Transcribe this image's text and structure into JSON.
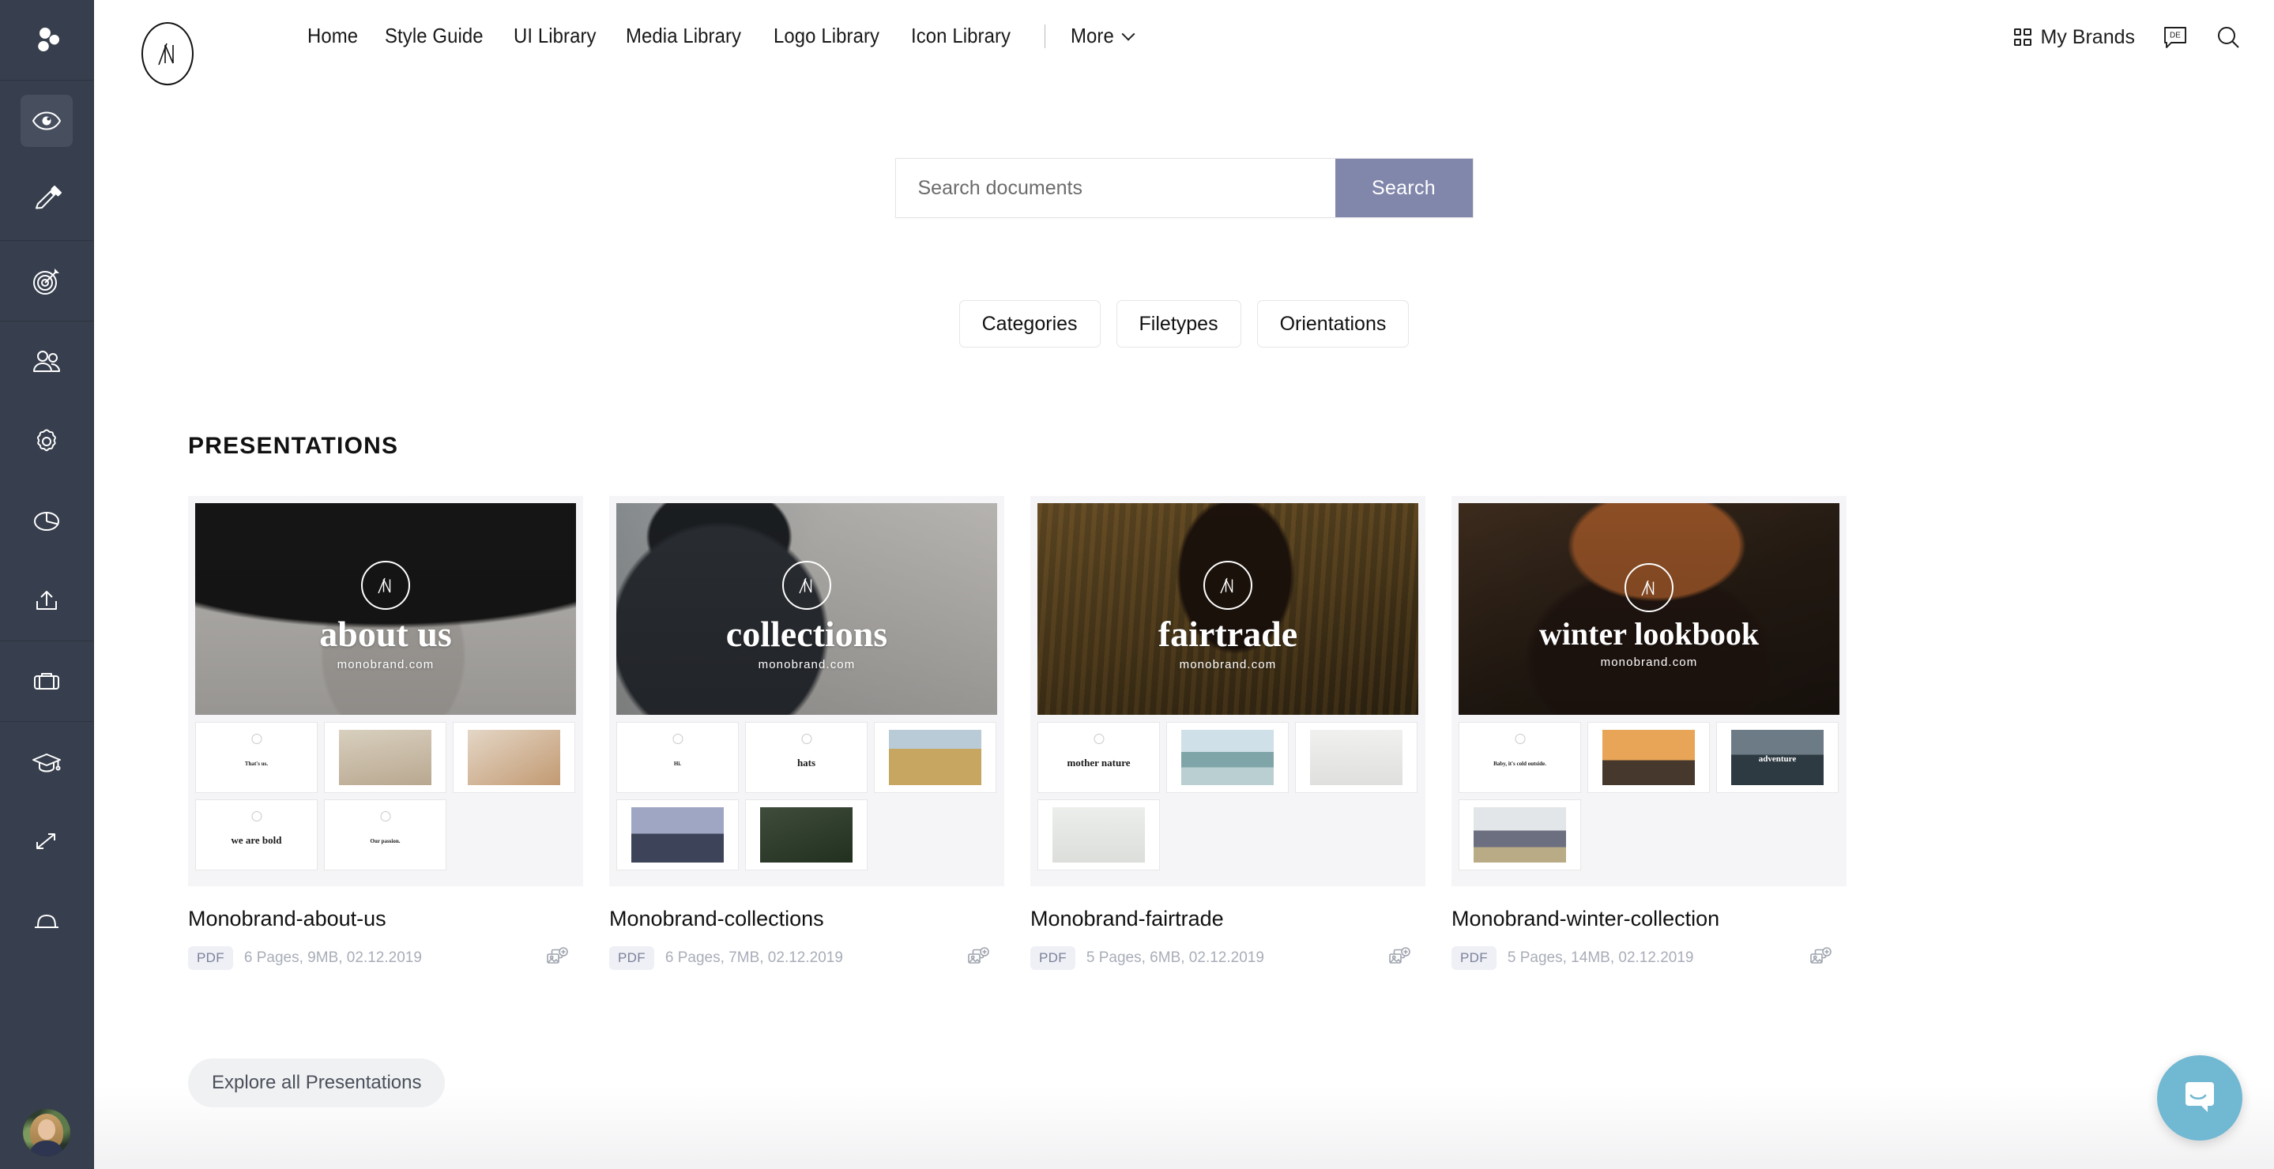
{
  "theme": {
    "sidebar_bg": "#373e4d",
    "sidebar_active_bg": "#474e5e",
    "search_button_bg": "#8186ab",
    "chat_fab_bg": "#71b8d2",
    "page_bg": "#ffffff",
    "card_thumb_bg": "#f5f5f7",
    "muted_text": "#a9adb8",
    "pdf_badge_bg": "#eef0f6"
  },
  "sidebar": {
    "groups": [
      {
        "items": [
          {
            "name": "brand-logo",
            "icon": "clover-logo-icon",
            "active": false
          }
        ]
      },
      {
        "items": [
          {
            "name": "preview",
            "icon": "eye-icon",
            "active": true
          },
          {
            "name": "edit",
            "icon": "pencil-icon",
            "active": false
          }
        ]
      },
      {
        "items": [
          {
            "name": "goals",
            "icon": "target-icon",
            "active": false
          }
        ]
      },
      {
        "items": [
          {
            "name": "users",
            "icon": "people-icon",
            "active": false
          },
          {
            "name": "settings",
            "icon": "gear-icon",
            "active": false
          },
          {
            "name": "analytics",
            "icon": "pie-chart-icon",
            "active": false
          },
          {
            "name": "share",
            "icon": "upload-share-icon",
            "active": false
          }
        ]
      },
      {
        "items": [
          {
            "name": "portfolio",
            "icon": "briefcase-icon",
            "active": false
          }
        ]
      },
      {
        "items": [
          {
            "name": "academy",
            "icon": "graduation-cap-icon",
            "active": false
          },
          {
            "name": "expand",
            "icon": "expand-arrows-icon",
            "active": false
          },
          {
            "name": "notifications",
            "icon": "bell-icon",
            "active": false
          }
        ]
      }
    ],
    "avatar_name": "user-avatar"
  },
  "header": {
    "logo_letter": "M",
    "nav_links": [
      "Home",
      "Style Guide",
      "UI Library",
      "Media Library",
      "Logo Library",
      "Icon Library"
    ],
    "more_label": "More",
    "my_brands_label": "My Brands",
    "language_code": "DE",
    "search_icon_name": "search-icon"
  },
  "search": {
    "placeholder": "Search documents",
    "button_label": "Search",
    "value": ""
  },
  "filters": [
    "Categories",
    "Filetypes",
    "Orientations"
  ],
  "section": {
    "title": "PRESENTATIONS",
    "explore_label": "Explore all Presentations"
  },
  "cards": [
    {
      "id": "about-us",
      "cover_title": "about us",
      "cover_url": "monobrand.com",
      "title": "Monobrand-about-us",
      "filetype": "PDF",
      "meta": "6 Pages, 9MB, 02.12.2019",
      "action_icon": "add-to-collection-icon",
      "slides": [
        {
          "type": "text",
          "label": "That's us.",
          "size": "tiny"
        },
        {
          "type": "photo",
          "tone": "warm-people"
        },
        {
          "type": "photo",
          "tone": "warm-group"
        },
        {
          "type": "text",
          "label": "we are bold",
          "size": "big"
        },
        {
          "type": "text",
          "label": "Our passion.",
          "size": "tiny"
        }
      ]
    },
    {
      "id": "collections",
      "cover_title": "collections",
      "cover_url": "monobrand.com",
      "title": "Monobrand-collections",
      "filetype": "PDF",
      "meta": "6 Pages, 7MB, 02.12.2019",
      "action_icon": "add-to-collection-icon",
      "slides": [
        {
          "type": "text",
          "label": "Hi.",
          "size": "tiny"
        },
        {
          "type": "text",
          "label": "hats",
          "size": "big"
        },
        {
          "type": "photo",
          "tone": "field"
        },
        {
          "type": "photo",
          "tone": "dusk"
        },
        {
          "type": "photo",
          "tone": "portrait"
        }
      ]
    },
    {
      "id": "fairtrade",
      "cover_title": "fairtrade",
      "cover_url": "monobrand.com",
      "title": "Monobrand-fairtrade",
      "filetype": "PDF",
      "meta": "5 Pages, 6MB, 02.12.2019",
      "action_icon": "add-to-collection-icon",
      "slides": [
        {
          "type": "text",
          "label": "mother nature",
          "size": "big"
        },
        {
          "type": "photo",
          "tone": "lake"
        },
        {
          "type": "photo",
          "tone": "plant"
        },
        {
          "type": "photo",
          "tone": "leaf"
        }
      ]
    },
    {
      "id": "winter-collection",
      "cover_title": "winter lookbook",
      "cover_url": "monobrand.com",
      "title": "Monobrand-winter-collection",
      "filetype": "PDF",
      "meta": "5 Pages, 14MB, 02.12.2019",
      "action_icon": "add-to-collection-icon",
      "slides": [
        {
          "type": "text",
          "label": "Baby, it's cold outside.",
          "size": "tiny"
        },
        {
          "type": "photo",
          "tone": "sunset"
        },
        {
          "type": "photo",
          "tone": "adventure",
          "caption": "adventure"
        },
        {
          "type": "photo",
          "tone": "mountains"
        }
      ]
    }
  ],
  "chat": {
    "name": "intercom-chat-button"
  }
}
